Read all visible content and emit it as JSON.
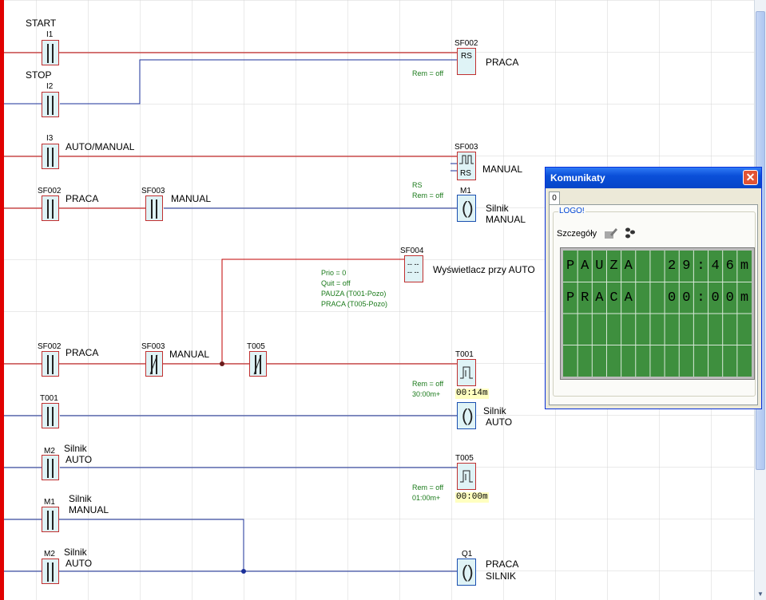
{
  "diagram": {
    "inputs": [
      {
        "id": "I1",
        "label": "START"
      },
      {
        "id": "I2",
        "label": "STOP"
      },
      {
        "id": "I3",
        "label": "AUTO/MANUAL"
      }
    ],
    "contacts": {
      "sf002_a": {
        "id": "SF002",
        "label": "PRACA"
      },
      "sf003_a": {
        "id": "SF003",
        "label": "MANUAL"
      },
      "sf002_b": {
        "id": "SF002",
        "label": "PRACA"
      },
      "sf003_b": {
        "id": "SF003",
        "label": "MANUAL"
      },
      "t005_c": {
        "id": "T005"
      },
      "t001_c": {
        "id": "T001"
      },
      "m2_a": {
        "id": "M2",
        "label1": "Silnik",
        "label2": "AUTO"
      },
      "m1_c": {
        "id": "M1",
        "label1": "Silnik",
        "label2": "MANUAL"
      },
      "m2_b": {
        "id": "M2",
        "label1": "Silnik",
        "label2": "AUTO"
      }
    },
    "blocks": {
      "sf002": {
        "id": "SF002",
        "symbol": "RS",
        "label": "PRACA",
        "param": "Rem = off"
      },
      "sf003": {
        "id": "SF003",
        "symbol": "RS",
        "label": "MANUAL",
        "param1": "RS",
        "param2": "Rem = off"
      },
      "m1": {
        "id": "M1",
        "label1": "Silnik",
        "label2": "MANUAL"
      },
      "sf004": {
        "id": "SF004",
        "label": "Wyświetlacz przy AUTO",
        "params": [
          "Prio = 0",
          "Quit = off",
          "PAUZA (T001-Pozo)",
          "PRACA (T005-Pozo)"
        ]
      },
      "t001": {
        "id": "T001",
        "param1": "Rem = off",
        "param2": "30:00m+",
        "value": "00:14m"
      },
      "silnik_auto": {
        "label1": "Silnik",
        "label2": "AUTO"
      },
      "t005": {
        "id": "T005",
        "param1": "Rem = off",
        "param2": "01:00m+",
        "value": "00:00m"
      },
      "q1": {
        "id": "Q1",
        "label1": "PRACA",
        "label2": "SILNIK"
      }
    }
  },
  "dialog": {
    "title": "Komunikaty",
    "close": "✕",
    "tab": "0",
    "group": "LOGO!",
    "details_label": "Szczegóły",
    "lcd_rows": [
      [
        "P",
        "A",
        "U",
        "Z",
        "A",
        " ",
        " ",
        "2",
        "9",
        ":",
        "4",
        "6",
        "m"
      ],
      [
        "P",
        "R",
        "A",
        "C",
        "A",
        " ",
        " ",
        "0",
        "0",
        ":",
        "0",
        "0",
        "m"
      ],
      [
        " ",
        " ",
        " ",
        " ",
        " ",
        " ",
        " ",
        " ",
        " ",
        " ",
        " ",
        " ",
        " "
      ],
      [
        " ",
        " ",
        " ",
        " ",
        " ",
        " ",
        " ",
        " ",
        " ",
        " ",
        " ",
        " ",
        " "
      ]
    ]
  },
  "colors": {
    "accent_wire": "#c00000",
    "signal_wire": "#1a2f99",
    "power_rail": "#e00000",
    "lcd_green": "#3e8f3e"
  },
  "icons": [
    "edit-icon",
    "steps-icon",
    "close-icon",
    "chevron-down-icon"
  ]
}
